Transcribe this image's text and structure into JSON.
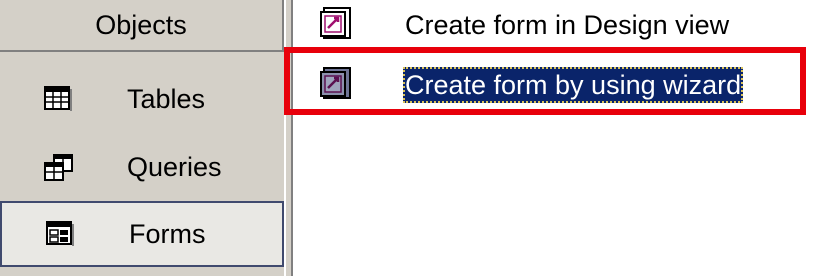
{
  "objects_pane": {
    "header": "Objects",
    "items": [
      {
        "label": "Tables",
        "icon": "table-icon"
      },
      {
        "label": "Queries",
        "icon": "query-icon"
      },
      {
        "label": "Forms",
        "icon": "form-icon",
        "selected": true
      }
    ]
  },
  "list_pane": {
    "items": [
      {
        "label": "Create form in Design view",
        "icon": "design-form-icon"
      },
      {
        "label": "Create form by using wizard",
        "icon": "wizard-form-icon",
        "selected": true
      }
    ]
  },
  "colors": {
    "selection": "#0a246a",
    "highlight_box": "#e8000b",
    "panel": "#d4d0c8"
  }
}
